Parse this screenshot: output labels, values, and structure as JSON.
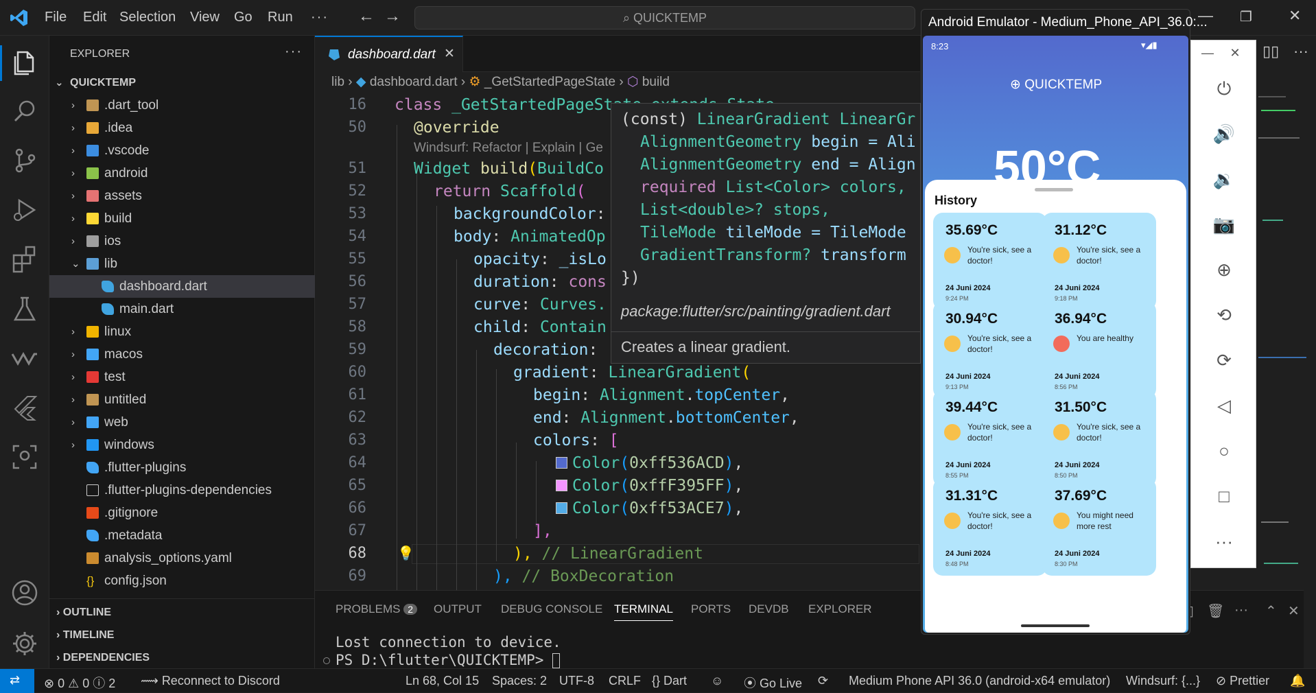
{
  "menu": [
    "File",
    "Edit",
    "Selection",
    "View",
    "Go",
    "Run"
  ],
  "command_center": "QUICKTEMP",
  "explorer": {
    "title": "EXPLORER",
    "root": "QUICKTEMP",
    "items": [
      {
        "label": ".dart_tool",
        "type": "folder",
        "color": "#c09553"
      },
      {
        "label": ".idea",
        "type": "folder",
        "color": "#e8a838"
      },
      {
        "label": ".vscode",
        "type": "folder",
        "color": "#3c8de0"
      },
      {
        "label": "android",
        "type": "folder",
        "color": "#8bc34a"
      },
      {
        "label": "assets",
        "type": "folder",
        "color": "#e57373"
      },
      {
        "label": "build",
        "type": "folder",
        "color": "#fdd835"
      },
      {
        "label": "ios",
        "type": "folder",
        "color": "#9e9e9e"
      },
      {
        "label": "lib",
        "type": "folder-open",
        "color": "#5c9fd6"
      },
      {
        "label": "dashboard.dart",
        "type": "dart",
        "color": "#40a4e0"
      },
      {
        "label": "main.dart",
        "type": "dart",
        "color": "#40a4e0"
      },
      {
        "label": "linux",
        "type": "folder",
        "color": "#f0b400"
      },
      {
        "label": "macos",
        "type": "folder",
        "color": "#42a5f5"
      },
      {
        "label": "test",
        "type": "folder",
        "color": "#e53935"
      },
      {
        "label": "untitled",
        "type": "folder",
        "color": "#c09553"
      },
      {
        "label": "web",
        "type": "folder",
        "color": "#42a5f5"
      },
      {
        "label": "windows",
        "type": "folder",
        "color": "#2196f3"
      },
      {
        "label": ".flutter-plugins",
        "type": "flutter",
        "color": "#42a5f5"
      },
      {
        "label": ".flutter-plugins-dependencies",
        "type": "file",
        "color": "#cccccc"
      },
      {
        "label": ".gitignore",
        "type": "git",
        "color": "#e64a19"
      },
      {
        "label": ".metadata",
        "type": "flutter",
        "color": "#42a5f5"
      },
      {
        "label": "analysis_options.yaml",
        "type": "yaml",
        "color": "#cb8b2f"
      },
      {
        "label": "config.json",
        "type": "json",
        "color": "#f1c40f"
      }
    ],
    "sections": [
      "OUTLINE",
      "TIMELINE",
      "DEPENDENCIES"
    ]
  },
  "tab": {
    "label": "dashboard.dart"
  },
  "breadcrumb": {
    "p1": "lib",
    "p2": "dashboard.dart",
    "p3": "_GetStartedPageState",
    "p4": "build"
  },
  "code": {
    "lines": [
      "16",
      "50",
      "",
      "51",
      "52",
      "53",
      "54",
      "55",
      "56",
      "57",
      "58",
      "59",
      "60",
      "61",
      "62",
      "63",
      "64",
      "65",
      "66",
      "67",
      "68",
      "69"
    ],
    "codelens": "Windsurf: Refactor | Explain | Ge",
    "l16a": "class ",
    "l16b": "_GetStartedPageState extends State",
    "l50": "@override",
    "l51a": "Widget ",
    "l51b": "build",
    "l51c": "(",
    "l51d": "BuildCo",
    "l52a": "return ",
    "l52b": "Scaffold",
    "l52c": "(",
    "l53a": "backgroundColor",
    ":": ":",
    "l54a": "body",
    "l54b": ": ",
    "l54c": "AnimatedOp",
    "l55a": "opacity",
    "l55b": ": ",
    "l55c": "_isLo",
    "l56a": "duration",
    "l56b": ": ",
    "l56c": "cons",
    "l57a": "curve",
    "l57b": ": ",
    "l57c": "Curves.",
    "l58a": "child",
    "l58b": ": ",
    "l58c": "Contain",
    "l59a": "decoration",
    "l59b": ": ",
    "l60a": "gradient",
    "l60b": ": ",
    "l60c": "LinearGradient",
    "l60d": "(",
    "l61a": "begin",
    "l61b": ": ",
    "l61c": "Alignment",
    "l61d": ".",
    "l61e": "topCenter",
    "l61f": ",",
    "l62a": "end",
    "l62b": ": ",
    "l62c": "Alignment",
    "l62d": ".",
    "l62e": "bottomCenter",
    "l62f": ",",
    "l63a": "colors",
    "l63b": ": ",
    "l63c": "[",
    "c1": "Color",
    "c1v": "0xff536ACD",
    "c1s": "#536acd",
    "c2": "Color",
    "c2v": "0xffF395FF",
    "c2s": "#f395ff",
    "c3": "Color",
    "c3v": "0xff53ACE7",
    "c3s": "#53ace7",
    "l67": "],",
    "l68a": "), ",
    "l68b": "// LinearGradient",
    "l69a": "), ",
    "l69b": "// BoxDecoration"
  },
  "hover": {
    "h1a": "(const) ",
    "h1b": "LinearGradient LinearGr",
    "h2a": "AlignmentGeometry ",
    "h2b": "begin = Ali",
    "h3a": "AlignmentGeometry ",
    "h3b": "end = Align",
    "h4a": "required ",
    "h4b": "List<Color> colors,",
    "h5": "List<double>? stops,",
    "h6a": "TileMode ",
    "h6b": "tileMode = TileMode",
    "h7a": "GradientTransform? ",
    "h7b": "transform",
    "h8": "})",
    "package": "package:flutter/src/painting/gradient.dart",
    "doc": "Creates a linear gradient."
  },
  "panel": {
    "tabs": [
      "PROBLEMS",
      "OUTPUT",
      "DEBUG CONSOLE",
      "TERMINAL",
      "PORTS",
      "DEVDB",
      "EXPLORER"
    ],
    "problems_count": "2",
    "terminal_line1": "Lost connection to device.",
    "terminal_line2": "PS D:\\flutter\\QUICKTEMP> "
  },
  "status": {
    "errors": "0",
    "warnings": "0",
    "info": "2",
    "discord": "Reconnect to Discord",
    "position": "Ln 68, Col 15",
    "spaces": "Spaces: 2",
    "encoding": "UTF-8",
    "eol": "CRLF",
    "language": "Dart",
    "golive": "Go Live",
    "device": "Medium Phone API 36.0 (android-x64 emulator)",
    "windsurf": "Windsurf: {...}",
    "prettier": "Prettier"
  },
  "emulator": {
    "title": "Android Emulator - Medium_Phone_API_36.0:...",
    "clock": "8:23",
    "app_title": "QUICKTEMP",
    "big_temp": "50°C",
    "history_title": "History",
    "cards": [
      {
        "temp": "35.69°C",
        "msg": "You're sick, see a doctor!",
        "date": "24 Juni 2024",
        "time": "9:24 PM",
        "emoji": "#f7c04a"
      },
      {
        "temp": "31.12°C",
        "msg": "You're sick, see a doctor!",
        "date": "24 Juni 2024",
        "time": "9:18 PM",
        "emoji": "#f7c04a"
      },
      {
        "temp": "30.94°C",
        "msg": "You're sick, see a doctor!",
        "date": "24 Juni 2024",
        "time": "9:13 PM",
        "emoji": "#f7c04a"
      },
      {
        "temp": "36.94°C",
        "msg": "You are healthy",
        "date": "24 Juni 2024",
        "time": "8:56 PM",
        "emoji": "#f26b5b"
      },
      {
        "temp": "39.44°C",
        "msg": "You're sick, see a doctor!",
        "date": "24 Juni 2024",
        "time": "8:55 PM",
        "emoji": "#f7c04a"
      },
      {
        "temp": "31.50°C",
        "msg": "You're sick, see a doctor!",
        "date": "24 Juni 2024",
        "time": "8:50 PM",
        "emoji": "#f7c04a"
      },
      {
        "temp": "31.31°C",
        "msg": "You're sick, see a doctor!",
        "date": "24 Juni 2024",
        "time": "8:48 PM",
        "emoji": "#f7c04a"
      },
      {
        "temp": "37.69°C",
        "msg": "You might need more rest",
        "date": "24 Juni 2024",
        "time": "8:30 PM",
        "emoji": "#f7c04a"
      }
    ]
  },
  "colors": {
    "accent": "#0078d4",
    "phone_top": "#536acd",
    "phone_bottom": "#53ace7",
    "card": "#b3e5fc"
  }
}
